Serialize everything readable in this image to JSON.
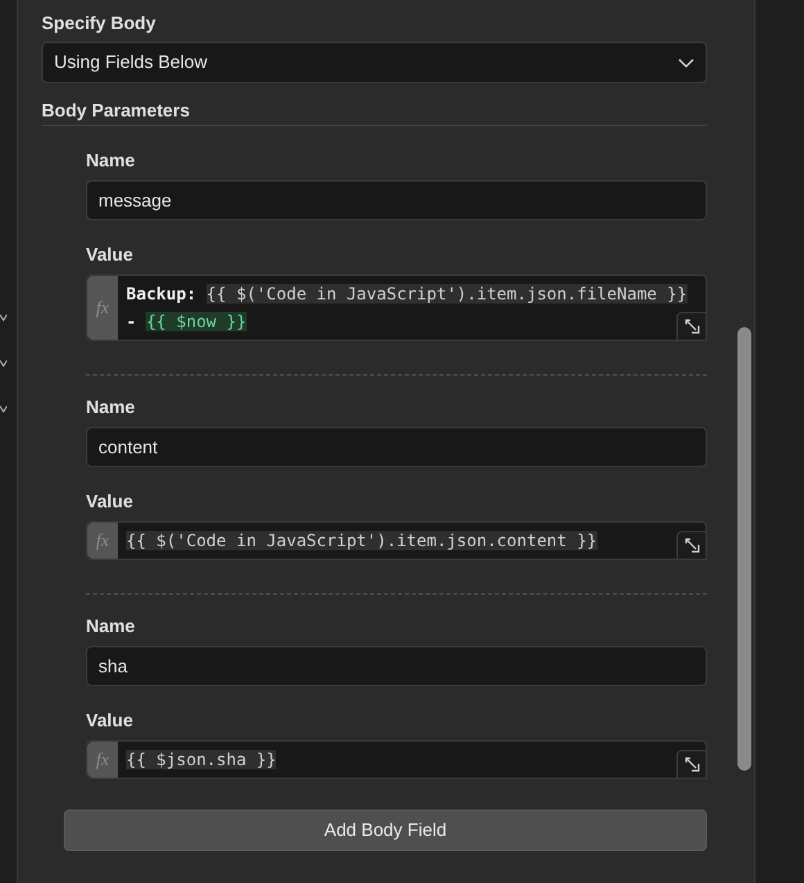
{
  "specify_body": {
    "label": "Specify Body",
    "value": "Using Fields Below"
  },
  "body_parameters": {
    "label": "Body Parameters",
    "items": [
      {
        "name_label": "Name",
        "name": "message",
        "value_label": "Value",
        "fx": "fx",
        "segments": [
          {
            "kind": "text",
            "text": "Backup: "
          },
          {
            "kind": "expression",
            "text": "{{ $('Code in JavaScript').item.json.fileName }}"
          },
          {
            "kind": "text",
            "text": " - "
          },
          {
            "kind": "resolved",
            "text": "{{ $now }}"
          }
        ]
      },
      {
        "name_label": "Name",
        "name": "content",
        "value_label": "Value",
        "fx": "fx",
        "segments": [
          {
            "kind": "expression",
            "text": "{{ $('Code in JavaScript').item.json.content }}"
          }
        ]
      },
      {
        "name_label": "Name",
        "name": "sha",
        "value_label": "Value",
        "fx": "fx",
        "segments": [
          {
            "kind": "expression",
            "text": "{{ $json.sha }}"
          }
        ]
      }
    ]
  },
  "add_button": "Add Body Field"
}
